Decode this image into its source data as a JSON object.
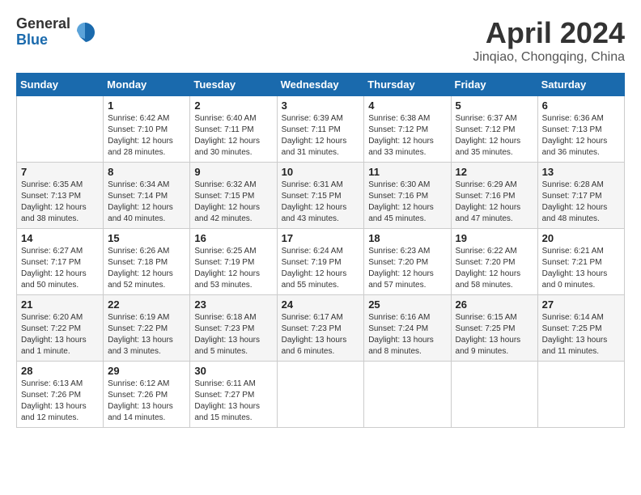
{
  "logo": {
    "general": "General",
    "blue": "Blue"
  },
  "title": "April 2024",
  "location": "Jinqiao, Chongqing, China",
  "weekdays": [
    "Sunday",
    "Monday",
    "Tuesday",
    "Wednesday",
    "Thursday",
    "Friday",
    "Saturday"
  ],
  "weeks": [
    [
      {
        "num": "",
        "sunrise": "",
        "sunset": "",
        "daylight": ""
      },
      {
        "num": "1",
        "sunrise": "Sunrise: 6:42 AM",
        "sunset": "Sunset: 7:10 PM",
        "daylight": "Daylight: 12 hours and 28 minutes."
      },
      {
        "num": "2",
        "sunrise": "Sunrise: 6:40 AM",
        "sunset": "Sunset: 7:11 PM",
        "daylight": "Daylight: 12 hours and 30 minutes."
      },
      {
        "num": "3",
        "sunrise": "Sunrise: 6:39 AM",
        "sunset": "Sunset: 7:11 PM",
        "daylight": "Daylight: 12 hours and 31 minutes."
      },
      {
        "num": "4",
        "sunrise": "Sunrise: 6:38 AM",
        "sunset": "Sunset: 7:12 PM",
        "daylight": "Daylight: 12 hours and 33 minutes."
      },
      {
        "num": "5",
        "sunrise": "Sunrise: 6:37 AM",
        "sunset": "Sunset: 7:12 PM",
        "daylight": "Daylight: 12 hours and 35 minutes."
      },
      {
        "num": "6",
        "sunrise": "Sunrise: 6:36 AM",
        "sunset": "Sunset: 7:13 PM",
        "daylight": "Daylight: 12 hours and 36 minutes."
      }
    ],
    [
      {
        "num": "7",
        "sunrise": "Sunrise: 6:35 AM",
        "sunset": "Sunset: 7:13 PM",
        "daylight": "Daylight: 12 hours and 38 minutes."
      },
      {
        "num": "8",
        "sunrise": "Sunrise: 6:34 AM",
        "sunset": "Sunset: 7:14 PM",
        "daylight": "Daylight: 12 hours and 40 minutes."
      },
      {
        "num": "9",
        "sunrise": "Sunrise: 6:32 AM",
        "sunset": "Sunset: 7:15 PM",
        "daylight": "Daylight: 12 hours and 42 minutes."
      },
      {
        "num": "10",
        "sunrise": "Sunrise: 6:31 AM",
        "sunset": "Sunset: 7:15 PM",
        "daylight": "Daylight: 12 hours and 43 minutes."
      },
      {
        "num": "11",
        "sunrise": "Sunrise: 6:30 AM",
        "sunset": "Sunset: 7:16 PM",
        "daylight": "Daylight: 12 hours and 45 minutes."
      },
      {
        "num": "12",
        "sunrise": "Sunrise: 6:29 AM",
        "sunset": "Sunset: 7:16 PM",
        "daylight": "Daylight: 12 hours and 47 minutes."
      },
      {
        "num": "13",
        "sunrise": "Sunrise: 6:28 AM",
        "sunset": "Sunset: 7:17 PM",
        "daylight": "Daylight: 12 hours and 48 minutes."
      }
    ],
    [
      {
        "num": "14",
        "sunrise": "Sunrise: 6:27 AM",
        "sunset": "Sunset: 7:17 PM",
        "daylight": "Daylight: 12 hours and 50 minutes."
      },
      {
        "num": "15",
        "sunrise": "Sunrise: 6:26 AM",
        "sunset": "Sunset: 7:18 PM",
        "daylight": "Daylight: 12 hours and 52 minutes."
      },
      {
        "num": "16",
        "sunrise": "Sunrise: 6:25 AM",
        "sunset": "Sunset: 7:19 PM",
        "daylight": "Daylight: 12 hours and 53 minutes."
      },
      {
        "num": "17",
        "sunrise": "Sunrise: 6:24 AM",
        "sunset": "Sunset: 7:19 PM",
        "daylight": "Daylight: 12 hours and 55 minutes."
      },
      {
        "num": "18",
        "sunrise": "Sunrise: 6:23 AM",
        "sunset": "Sunset: 7:20 PM",
        "daylight": "Daylight: 12 hours and 57 minutes."
      },
      {
        "num": "19",
        "sunrise": "Sunrise: 6:22 AM",
        "sunset": "Sunset: 7:20 PM",
        "daylight": "Daylight: 12 hours and 58 minutes."
      },
      {
        "num": "20",
        "sunrise": "Sunrise: 6:21 AM",
        "sunset": "Sunset: 7:21 PM",
        "daylight": "Daylight: 13 hours and 0 minutes."
      }
    ],
    [
      {
        "num": "21",
        "sunrise": "Sunrise: 6:20 AM",
        "sunset": "Sunset: 7:22 PM",
        "daylight": "Daylight: 13 hours and 1 minute."
      },
      {
        "num": "22",
        "sunrise": "Sunrise: 6:19 AM",
        "sunset": "Sunset: 7:22 PM",
        "daylight": "Daylight: 13 hours and 3 minutes."
      },
      {
        "num": "23",
        "sunrise": "Sunrise: 6:18 AM",
        "sunset": "Sunset: 7:23 PM",
        "daylight": "Daylight: 13 hours and 5 minutes."
      },
      {
        "num": "24",
        "sunrise": "Sunrise: 6:17 AM",
        "sunset": "Sunset: 7:23 PM",
        "daylight": "Daylight: 13 hours and 6 minutes."
      },
      {
        "num": "25",
        "sunrise": "Sunrise: 6:16 AM",
        "sunset": "Sunset: 7:24 PM",
        "daylight": "Daylight: 13 hours and 8 minutes."
      },
      {
        "num": "26",
        "sunrise": "Sunrise: 6:15 AM",
        "sunset": "Sunset: 7:25 PM",
        "daylight": "Daylight: 13 hours and 9 minutes."
      },
      {
        "num": "27",
        "sunrise": "Sunrise: 6:14 AM",
        "sunset": "Sunset: 7:25 PM",
        "daylight": "Daylight: 13 hours and 11 minutes."
      }
    ],
    [
      {
        "num": "28",
        "sunrise": "Sunrise: 6:13 AM",
        "sunset": "Sunset: 7:26 PM",
        "daylight": "Daylight: 13 hours and 12 minutes."
      },
      {
        "num": "29",
        "sunrise": "Sunrise: 6:12 AM",
        "sunset": "Sunset: 7:26 PM",
        "daylight": "Daylight: 13 hours and 14 minutes."
      },
      {
        "num": "30",
        "sunrise": "Sunrise: 6:11 AM",
        "sunset": "Sunset: 7:27 PM",
        "daylight": "Daylight: 13 hours and 15 minutes."
      },
      {
        "num": "",
        "sunrise": "",
        "sunset": "",
        "daylight": ""
      },
      {
        "num": "",
        "sunrise": "",
        "sunset": "",
        "daylight": ""
      },
      {
        "num": "",
        "sunrise": "",
        "sunset": "",
        "daylight": ""
      },
      {
        "num": "",
        "sunrise": "",
        "sunset": "",
        "daylight": ""
      }
    ]
  ]
}
